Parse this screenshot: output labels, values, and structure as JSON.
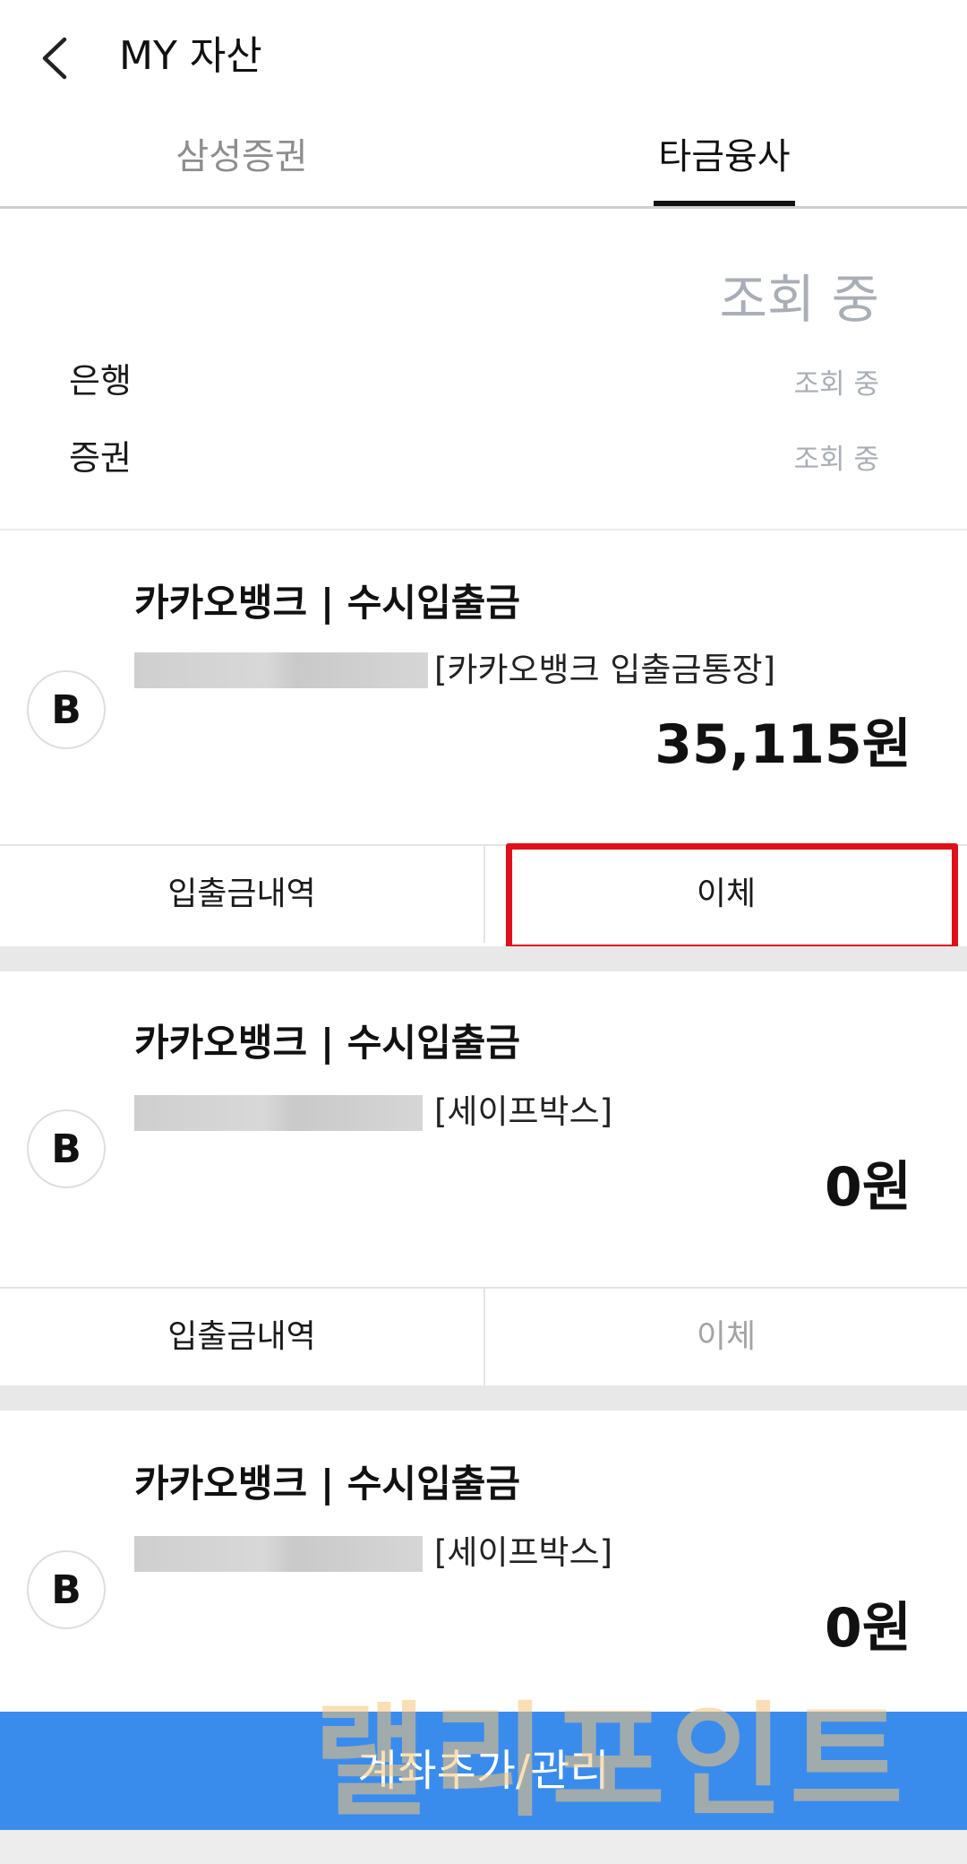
{
  "header": {
    "title": "MY 자산"
  },
  "tabs": [
    {
      "label": "삼성증권",
      "active": false
    },
    {
      "label": "타금융사",
      "active": true
    }
  ],
  "summary": {
    "total_status": "조회 중",
    "rows": [
      {
        "label": "은행",
        "value": "조회 중"
      },
      {
        "label": "증권",
        "value": "조회 중"
      }
    ]
  },
  "accounts": [
    {
      "logo_letter": "B",
      "title": "카카오뱅크 | 수시입출금",
      "nickname": "[카카오뱅크 입출금통장]",
      "balance": "35,115원",
      "history_label": "입출금내역",
      "transfer_label": "이체",
      "transfer_enabled": true
    },
    {
      "logo_letter": "B",
      "title": "카카오뱅크 | 수시입출금",
      "nickname": "[세이프박스]",
      "balance": "0원",
      "history_label": "입출금내역",
      "transfer_label": "이체",
      "transfer_enabled": false
    },
    {
      "logo_letter": "B",
      "title": "카카오뱅크 | 수시입출금",
      "nickname": "[세이프박스]",
      "balance": "0원"
    }
  ],
  "bottom_button": {
    "label": "계좌추가/관리"
  },
  "watermark": {
    "text": "랠리포인트"
  },
  "colors": {
    "primary_button": "#3a8cec",
    "highlight": "#e0101a",
    "muted_text": "#a9aeb6"
  }
}
